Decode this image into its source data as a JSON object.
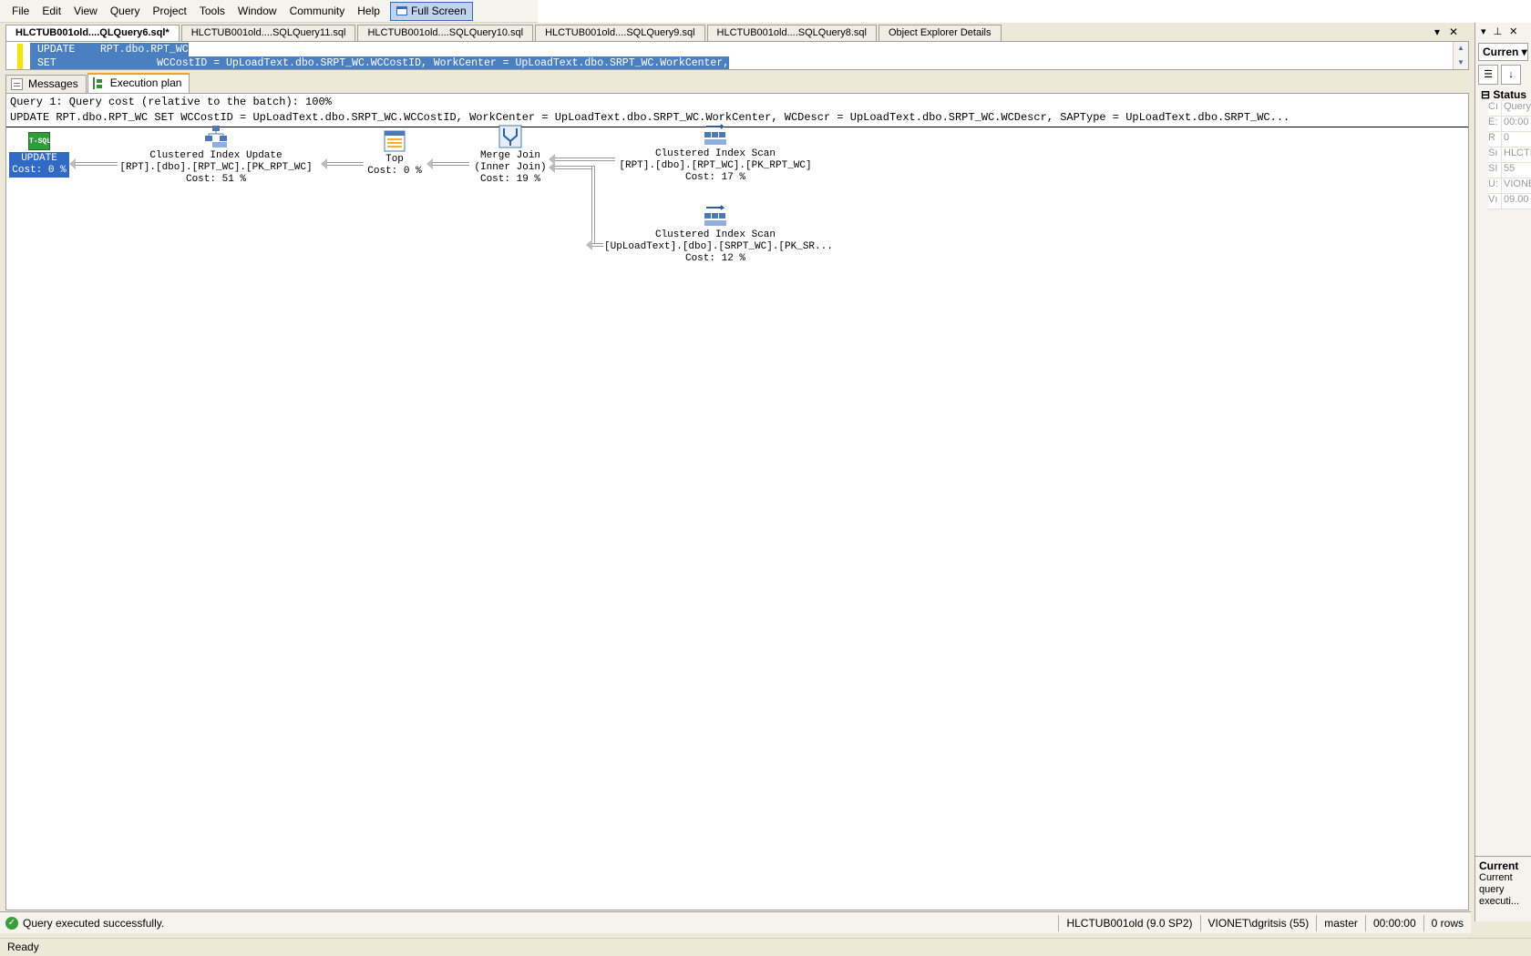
{
  "menu": {
    "items": [
      "File",
      "Edit",
      "View",
      "Query",
      "Project",
      "Tools",
      "Window",
      "Community",
      "Help"
    ],
    "fullscreen_label": "Full Screen"
  },
  "doc_tabs": [
    {
      "label": "HLCTUB001old....QLQuery6.sql*",
      "active": true
    },
    {
      "label": "HLCTUB001old....SQLQuery11.sql",
      "active": false
    },
    {
      "label": "HLCTUB001old....SQLQuery10.sql",
      "active": false
    },
    {
      "label": "HLCTUB001old....SQLQuery9.sql",
      "active": false
    },
    {
      "label": "HLCTUB001old....SQLQuery8.sql",
      "active": false
    },
    {
      "label": "Object Explorer Details",
      "active": false
    }
  ],
  "editor": {
    "line1": "UPDATE    RPT.dbo.RPT_WC",
    "line2": "SET                WCCostID = UpLoadText.dbo.SRPT_WC.WCCostID, WorkCenter = UpLoadText.dbo.SRPT_WC.WorkCenter,"
  },
  "result_tabs": {
    "messages": "Messages",
    "execution_plan": "Execution plan"
  },
  "plan": {
    "header1": "Query 1: Query cost (relative to the batch): 100%",
    "header2": "UPDATE RPT.dbo.RPT_WC SET WCCostID = UpLoadText.dbo.SRPT_WC.WCCostID, WorkCenter = UpLoadText.dbo.SRPT_WC.WorkCenter, WCDescr = UpLoadText.dbo.SRPT_WC.WCDescr, SAPType = UpLoadText.dbo.SRPT_WC...",
    "nodes": {
      "update": {
        "icon_text": "T-SQL",
        "name": "UPDATE",
        "cost": "Cost: 0 %"
      },
      "ci_update": {
        "name": "Clustered Index Update",
        "object": "[RPT].[dbo].[RPT_WC].[PK_RPT_WC]",
        "cost": "Cost: 51 %"
      },
      "top": {
        "name": "Top",
        "cost": "Cost: 0 %"
      },
      "merge": {
        "name": "Merge Join",
        "detail": "(Inner Join)",
        "cost": "Cost: 19 %"
      },
      "scan1": {
        "name": "Clustered Index Scan",
        "object": "[RPT].[dbo].[RPT_WC].[PK_RPT_WC]",
        "cost": "Cost: 17 %"
      },
      "scan2": {
        "name": "Clustered Index Scan",
        "object": "[UpLoadText].[dbo].[SRPT_WC].[PK_SR...",
        "cost": "Cost: 12 %"
      }
    }
  },
  "properties": {
    "selector": "Curren",
    "category": "Status",
    "rows": [
      {
        "k": "Cı",
        "v": "Query"
      },
      {
        "k": "E:",
        "v": "00:00"
      },
      {
        "k": "R",
        "v": "0"
      },
      {
        "k": "Sı",
        "v": "HLCTI"
      },
      {
        "k": "SI",
        "v": "55"
      },
      {
        "k": "U:",
        "v": "VIONE"
      },
      {
        "k": "Vı",
        "v": "09.00"
      }
    ],
    "desc_title": "Current",
    "desc_text": "Current query executi..."
  },
  "query_status": {
    "message": "Query executed successfully.",
    "server": "HLCTUB001old (9.0 SP2)",
    "user": "VIONET\\dgritsis (55)",
    "database": "master",
    "elapsed": "00:00:00",
    "rows": "0 rows"
  },
  "app_status": "Ready",
  "colors": {
    "selection": "#316ac5",
    "success": "#3a9d3a",
    "tab_highlight": "#e8a43a"
  }
}
